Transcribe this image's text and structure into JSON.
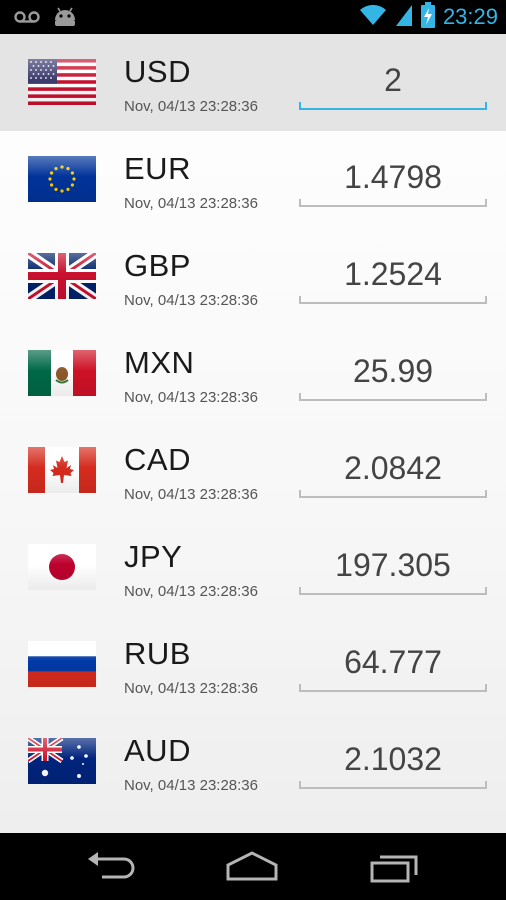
{
  "statusbar": {
    "time": "23:29",
    "icons": [
      "voicemail-icon",
      "android-icon",
      "wifi-icon",
      "signal-icon",
      "battery-charging-icon"
    ],
    "accent_color": "#33b5e5"
  },
  "rows": [
    {
      "code": "USD",
      "timestamp": "Nov, 04/13 23:28:36",
      "value": "2",
      "flag": "us-flag-icon",
      "selected": true
    },
    {
      "code": "EUR",
      "timestamp": "Nov, 04/13 23:28:36",
      "value": "1.4798",
      "flag": "eu-flag-icon"
    },
    {
      "code": "GBP",
      "timestamp": "Nov, 04/13 23:28:36",
      "value": "1.2524",
      "flag": "uk-flag-icon"
    },
    {
      "code": "MXN",
      "timestamp": "Nov, 04/13 23:28:36",
      "value": "25.99",
      "flag": "mexico-flag-icon"
    },
    {
      "code": "CAD",
      "timestamp": "Nov, 04/13 23:28:36",
      "value": "2.0842",
      "flag": "canada-flag-icon"
    },
    {
      "code": "JPY",
      "timestamp": "Nov, 04/13 23:28:36",
      "value": "197.305",
      "flag": "japan-flag-icon"
    },
    {
      "code": "RUB",
      "timestamp": "Nov, 04/13 23:28:36",
      "value": "64.777",
      "flag": "russia-flag-icon"
    },
    {
      "code": "AUD",
      "timestamp": "Nov, 04/13 23:28:36",
      "value": "2.1032",
      "flag": "australia-flag-icon"
    }
  ],
  "navbar": {
    "icons": [
      "back-icon",
      "home-icon",
      "recent-apps-icon"
    ]
  }
}
